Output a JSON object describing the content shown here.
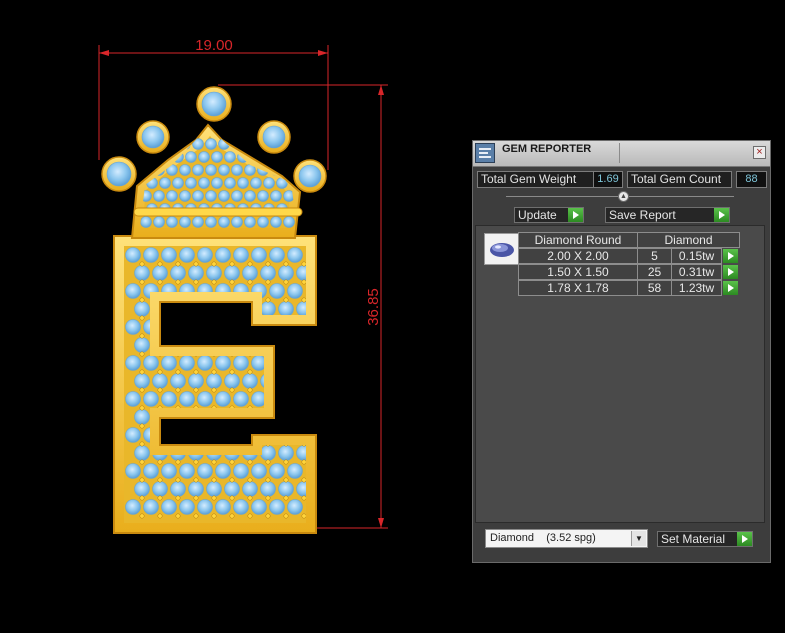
{
  "viewport": {
    "dimension_width": "19.00",
    "dimension_height": "36.85",
    "colors": {
      "dimension": "#d8262a",
      "gold": "#f4c834",
      "gem": "#8ec8ef"
    }
  },
  "panel": {
    "title": "GEM REPORTER",
    "close_label": "×",
    "total_gem_weight_label": "Total Gem Weight",
    "total_gem_weight_value": "1.69",
    "total_gem_count_label": "Total Gem Count",
    "total_gem_count_value": "88",
    "update_label": "Update",
    "save_report_label": "Save Report",
    "table": {
      "headers": [
        "Diamond Round",
        "Diamond"
      ],
      "rows": [
        {
          "size": "2.00 X 2.00",
          "count": "5",
          "weight": "0.15tw"
        },
        {
          "size": "1.50 X 1.50",
          "count": "25",
          "weight": "0.31tw"
        },
        {
          "size": "1.78 X 1.78",
          "count": "58",
          "weight": "1.23tw"
        }
      ]
    },
    "material": {
      "selected": "Diamond    (3.52 spg)",
      "arrow": "▼"
    },
    "set_material_label": "Set Material"
  }
}
